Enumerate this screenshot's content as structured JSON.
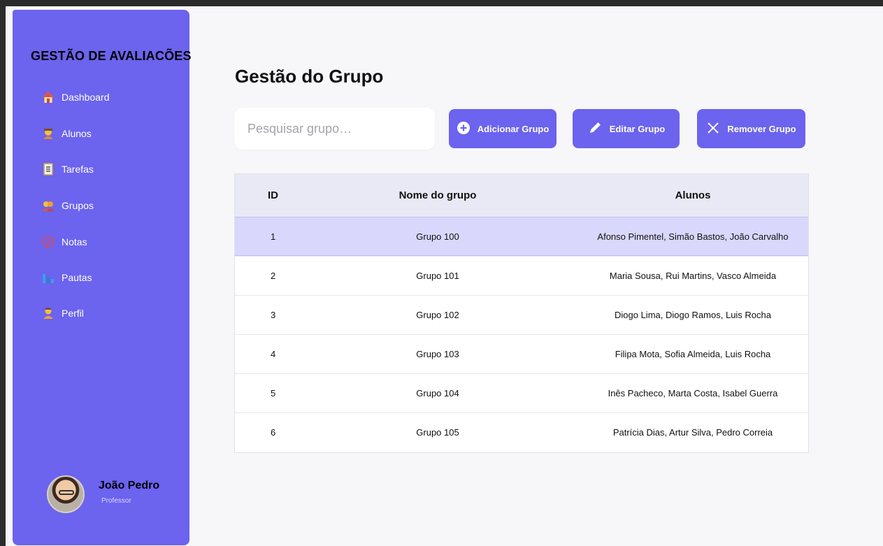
{
  "sidebar": {
    "brand": "GESTÃO DE AVALIACÕES",
    "items": [
      {
        "label": "Dashboard",
        "icon": "home-icon"
      },
      {
        "label": "Alunos",
        "icon": "student-icon"
      },
      {
        "label": "Tarefas",
        "icon": "clipboard-icon"
      },
      {
        "label": "Grupos",
        "icon": "group-icon"
      },
      {
        "label": "Notas",
        "icon": "grade-icon"
      },
      {
        "label": "Pautas",
        "icon": "chart-icon"
      },
      {
        "label": "Perfil",
        "icon": "profile-icon"
      }
    ],
    "user": {
      "name": "João Pedro",
      "role": "Professor"
    }
  },
  "main": {
    "title": "Gestão do Grupo",
    "search": {
      "placeholder": "Pesquisar grupo…",
      "value": ""
    },
    "buttons": {
      "add": "Adicionar Grupo",
      "edit": "Editar Grupo",
      "remove": "Remover Grupo"
    },
    "table": {
      "headers": [
        "ID",
        "Nome do grupo",
        "Alunos"
      ],
      "rows": [
        {
          "id": "1",
          "name": "Grupo 100",
          "alunos": "Afonso Pimentel, Simão Bastos, João Carvalho",
          "selected": true
        },
        {
          "id": "2",
          "name": "Grupo 101",
          "alunos": "Maria Sousa, Rui Martins, Vasco Almeida"
        },
        {
          "id": "3",
          "name": "Grupo 102",
          "alunos": "Diogo Lima, Diogo Ramos, Luis Rocha"
        },
        {
          "id": "4",
          "name": "Grupo 103",
          "alunos": "Filipa Mota, Sofia Almeida, Luis Rocha"
        },
        {
          "id": "5",
          "name": "Grupo 104",
          "alunos": "Inês Pacheco, Marta Costa, Isabel Guerra"
        },
        {
          "id": "6",
          "name": "Grupo 105",
          "alunos": "Patrícia Dias, Artur Silva, Pedro Correia"
        }
      ]
    }
  },
  "colors": {
    "accent": "#6c63ee",
    "header_bg": "#e9e9f6",
    "selected_row": "#d9d7fb"
  }
}
